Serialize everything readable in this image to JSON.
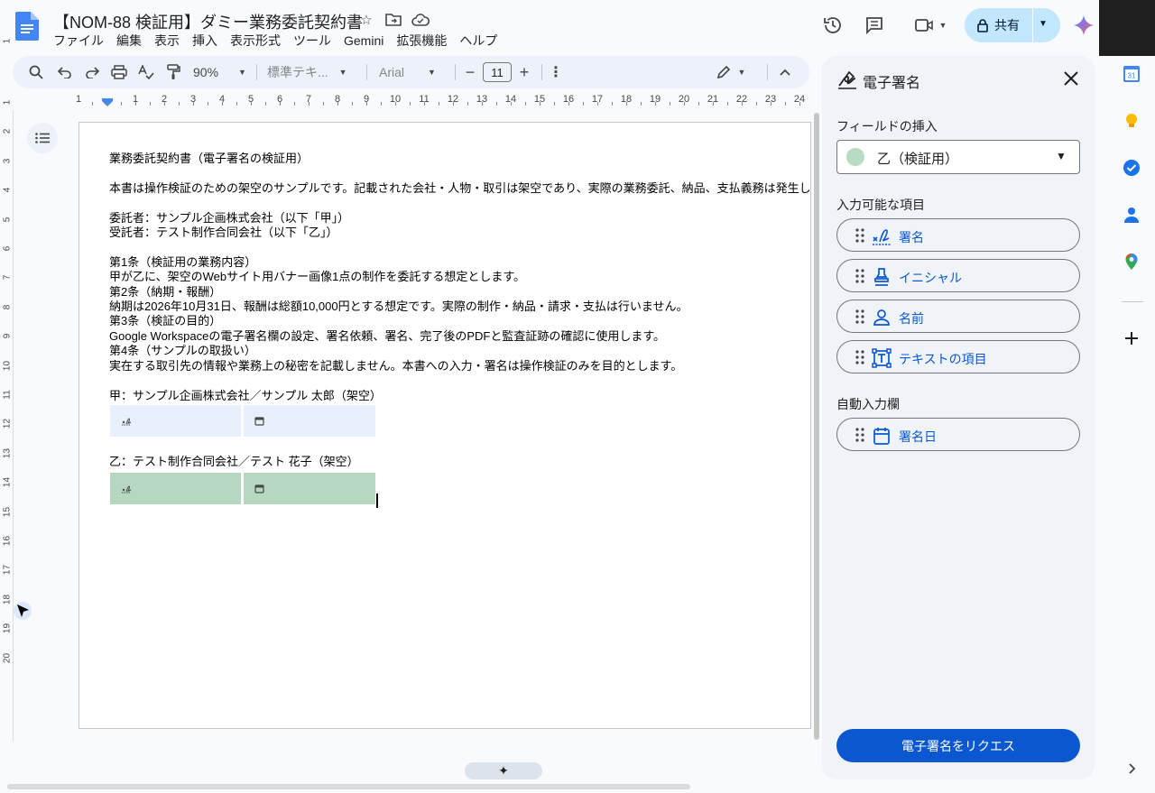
{
  "header": {
    "title": "【NOM-88 検証用】ダミー業務委託契約書",
    "menu": [
      "ファイル",
      "編集",
      "表示",
      "挿入",
      "表示形式",
      "ツール",
      "Gemini",
      "拡張機能",
      "ヘルプ"
    ],
    "share_label": "共有"
  },
  "toolbar": {
    "zoom": "90%",
    "style": "標準テキ...",
    "font": "Arial",
    "font_size": "11",
    "minus": "−",
    "plus": "+"
  },
  "ruler": {
    "numbers": [
      "1",
      "1",
      "2",
      "3",
      "4",
      "5",
      "6",
      "7",
      "8",
      "9",
      "10",
      "11",
      "12",
      "13",
      "14",
      "15",
      "16",
      "17",
      "18",
      "19",
      "20",
      "21",
      "22",
      "23",
      "24"
    ],
    "vertical_numbers": [
      "1",
      "1",
      "2",
      "3",
      "4",
      "5",
      "6",
      "7",
      "8",
      "9",
      "10",
      "11",
      "12",
      "13",
      "14",
      "15",
      "16",
      "17",
      "18",
      "19",
      "20"
    ]
  },
  "document": {
    "lines": [
      "業務委託契約書（電子署名の検証用）",
      "本書は操作検証のための架空のサンプルです。記載された会社・人物・取引は架空であり、実際の業務委託、納品、支払義務は発生しません。",
      "委託者：サンプル企画株式会社（以下「甲」）",
      "受託者：テスト制作合同会社（以下「乙」）",
      "第1条（検証用の業務内容）",
      "甲が乙に、架空のWebサイト用バナー画像1点の制作を委託する想定とします。",
      "第2条（納期・報酬）",
      "納期は2026年10月31日、報酬は総額10,000円とする想定です。実際の制作・納品・請求・支払は行いません。",
      "第3条（検証の目的）",
      "Google Workspaceの電子署名欄の設定、署名依頼、署名、完了後のPDFと監査証跡の確認に使用します。",
      "第4条（サンプルの取扱い）",
      "実在する取引先の情報や業務上の秘密を記載しません。本書への入力・署名は操作検証のみを目的とします。",
      "甲：サンプル企画株式会社／サンプル 太郎（架空）",
      "乙：テスト制作合同会社／テスト 花子（架空）"
    ],
    "field_color_a": "#e8f0fe",
    "field_color_b": "#b7d8c0"
  },
  "panel": {
    "title": "電子署名",
    "insert_label": "フィールドの挿入",
    "signer": "乙（検証用）",
    "signer_color": "#b7dcc3",
    "fillable_label": "入力可能な項目",
    "fields": [
      "署名",
      "イニシャル",
      "名前",
      "テキストの項目"
    ],
    "auto_label": "自動入力欄",
    "auto_fields": [
      "署名日"
    ],
    "request_button": "電子署名をリクエス"
  },
  "rail": {
    "calendar_badge": "31"
  },
  "colors": {
    "accent": "#0b57d0",
    "share_bg": "#c2e7ff",
    "toolbar_bg": "#edf2fa",
    "panel_bg": "#f0f4f9"
  }
}
